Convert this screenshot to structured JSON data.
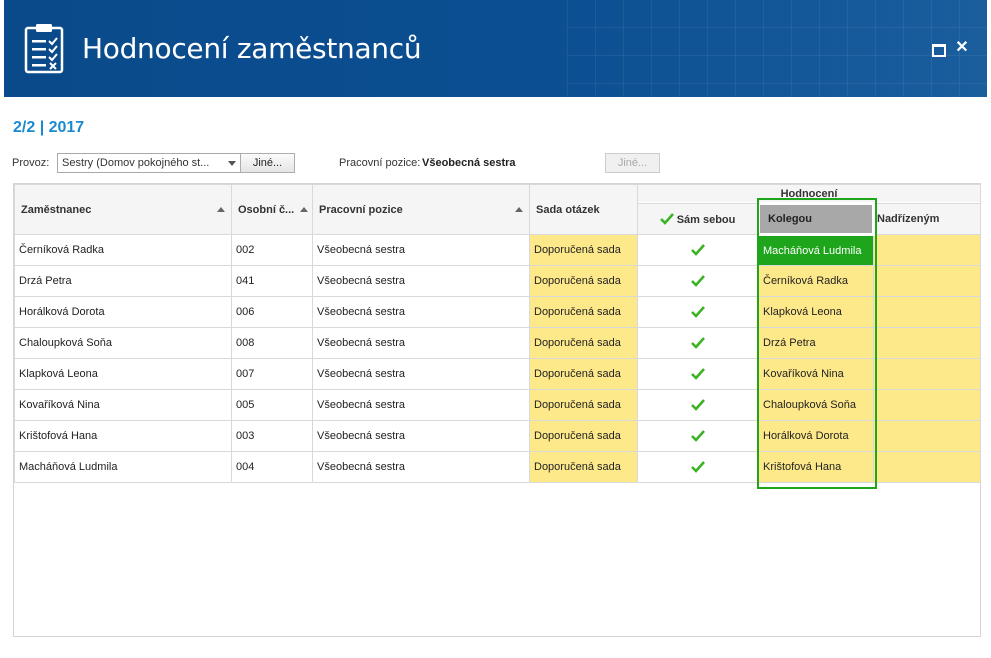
{
  "window": {
    "title": "Hodnocení zaměstnanců",
    "icons": {
      "app": "clipboard-checklist-icon",
      "maximize": "maximize-icon",
      "close": "close-icon"
    }
  },
  "period": "2/2 | 2017",
  "filters": {
    "provoz_label": "Provoz:",
    "provoz_value": "Sestry (Domov pokojného st...",
    "jine_button": "Jiné...",
    "pozice_label": "Pracovní pozice:",
    "pozice_value": "Všeobecná sestra",
    "jine_button2": "Jiné..."
  },
  "grid": {
    "columns": {
      "zamestnanec": "Zaměstnanec",
      "osobni": "Osobní č...",
      "pozice": "Pracovní pozice",
      "sada": "Sada otázek",
      "hodnoceni": "Hodnocení",
      "sam": "Sám sebou",
      "kolegou": "Kolegou",
      "nadrizenym": "Nadřízeným"
    },
    "rows": [
      {
        "name": "Černíková Radka",
        "num": "002",
        "position": "Všeobecná sestra",
        "set": "Doporučená sada",
        "self": true,
        "colleague": "Macháňová Ludmila",
        "selected": true
      },
      {
        "name": "Drzá Petra",
        "num": "041",
        "position": "Všeobecná sestra",
        "set": "Doporučená sada",
        "self": true,
        "colleague": "Černíková Radka",
        "selected": false
      },
      {
        "name": "Horálková Dorota",
        "num": "006",
        "position": "Všeobecná sestra",
        "set": "Doporučená sada",
        "self": true,
        "colleague": "Klapková Leona",
        "selected": false
      },
      {
        "name": "Chaloupková Soňa",
        "num": "008",
        "position": "Všeobecná sestra",
        "set": "Doporučená sada",
        "self": true,
        "colleague": "Drzá Petra",
        "selected": false
      },
      {
        "name": "Klapková Leona",
        "num": "007",
        "position": "Všeobecná sestra",
        "set": "Doporučená sada",
        "self": true,
        "colleague": "Kovaříková Nina",
        "selected": false
      },
      {
        "name": "Kovaříková Nina",
        "num": "005",
        "position": "Všeobecná sestra",
        "set": "Doporučená sada",
        "self": true,
        "colleague": "Chaloupková Soňa",
        "selected": false
      },
      {
        "name": "Krištofová Hana",
        "num": "003",
        "position": "Všeobecná sestra",
        "set": "Doporučená sada",
        "self": true,
        "colleague": "Horálková Dorota",
        "selected": false
      },
      {
        "name": "Macháňová Ludmila",
        "num": "004",
        "position": "Všeobecná sestra",
        "set": "Doporučená sada",
        "self": true,
        "colleague": "Krištofová Hana",
        "selected": false
      }
    ]
  },
  "colors": {
    "header": "#0b4f92",
    "accent": "#1a8ad0",
    "yellow": "#fde98a",
    "green": "#1ea51c"
  }
}
